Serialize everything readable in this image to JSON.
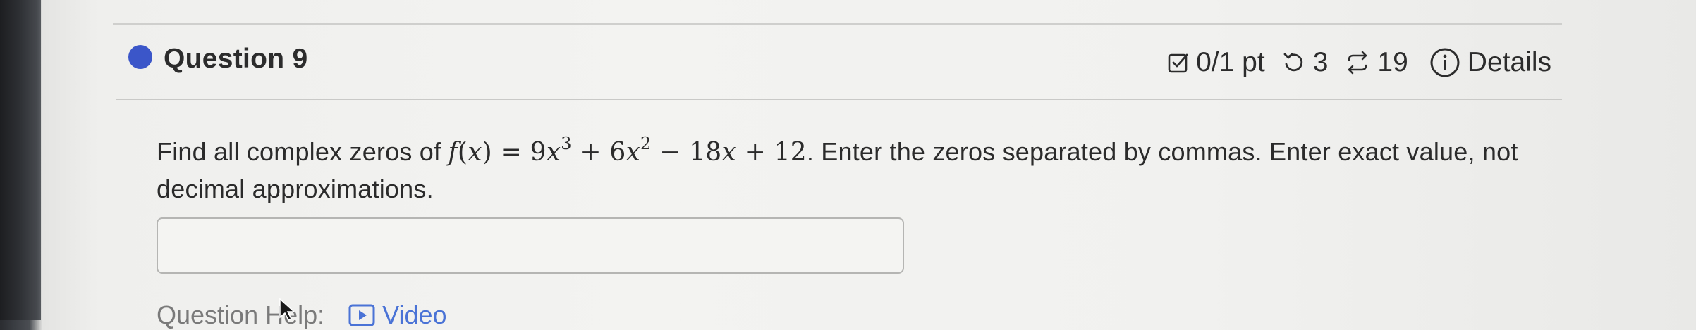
{
  "question": {
    "title": "Question 9",
    "score": "0/1 pt",
    "attempts": "3",
    "submissions": "19",
    "details_label": "Details",
    "status_color": "#3b56c9"
  },
  "prompt": {
    "lead": "Find all complex zeros of",
    "func_name": "f",
    "var": "x",
    "equals": "=",
    "term1_coef": "9",
    "term1_exp": "3",
    "plus1": "+",
    "term2_coef": "6",
    "term2_exp": "2",
    "minus": "−",
    "term3": "18",
    "plus2": "+",
    "constant": "12",
    "instruction": ". Enter the zeros separated by commas. Enter exact value, not decimal approximations."
  },
  "answer": {
    "value": ""
  },
  "help": {
    "label": "Question Help:",
    "video_label": "Video",
    "link_color": "#4a73d6"
  },
  "icons": {
    "score": "checkbox-icon",
    "attempts": "undo-icon",
    "submissions": "repeat-icon",
    "details": "info-icon",
    "video": "play-icon"
  }
}
